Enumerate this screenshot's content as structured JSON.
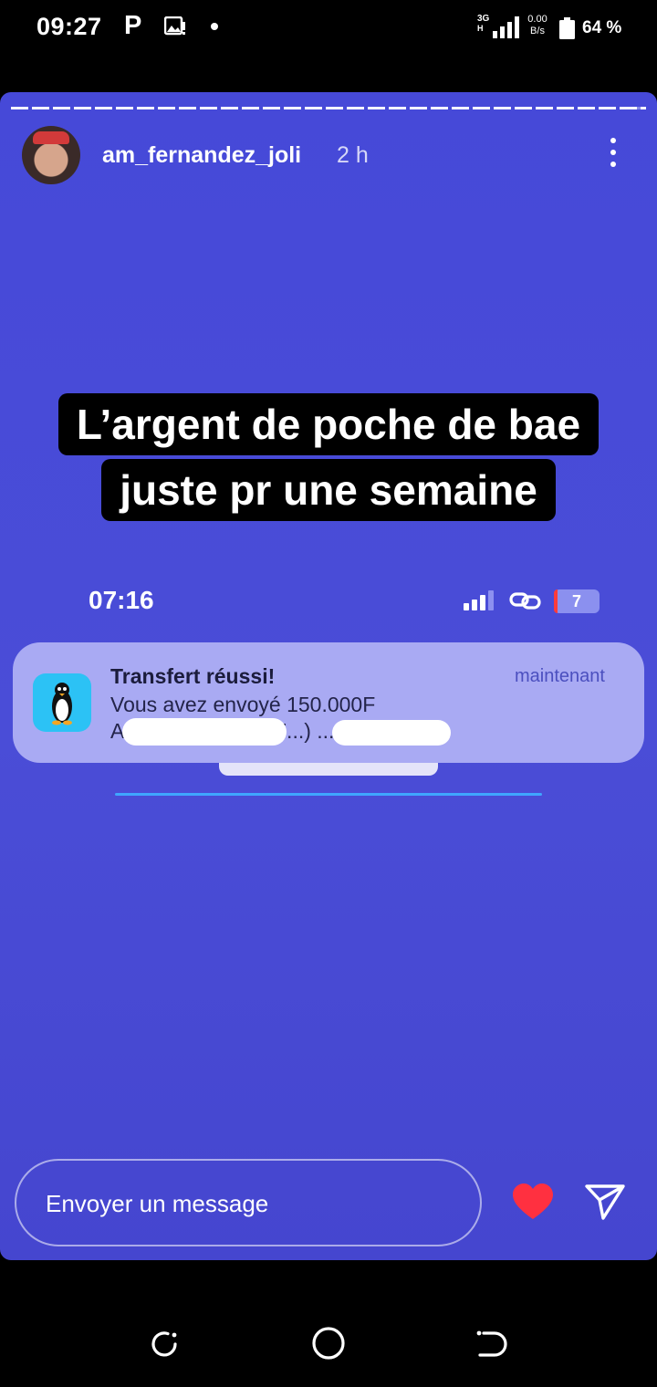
{
  "status_bar": {
    "time": "09:27",
    "p_icon": "P",
    "network_type": "3G",
    "network_sub": "H",
    "speed_value": "0.00",
    "speed_unit": "B/s",
    "battery_percent": "64 %"
  },
  "story": {
    "username": "am_fernandez_joli",
    "time_ago": "2 h",
    "caption_line1": "L’argent de poche de bae",
    "caption_line2": "juste pr une semaine",
    "inner_screenshot": {
      "time": "07:16",
      "battery_level": "7",
      "notification": {
        "title": "Transfert réussi!",
        "timestamp": "maintenant",
        "body_line1": "Vous avez envoyé 150.000F",
        "body_line2": "A ...ibrim (0707107...) ..."
      }
    }
  },
  "reply_bar": {
    "placeholder": "Envoyer un message"
  },
  "colors": {
    "story_bg": "#4649d8",
    "heart": "#ff3040",
    "notification_bg": "#a9aaf3"
  },
  "icons": [
    "image-icon",
    "signal-icon",
    "battery-icon",
    "more-icon",
    "penguin-app-icon",
    "link-icon",
    "heart-icon",
    "send-icon",
    "recents-icon",
    "home-icon",
    "back-icon"
  ]
}
